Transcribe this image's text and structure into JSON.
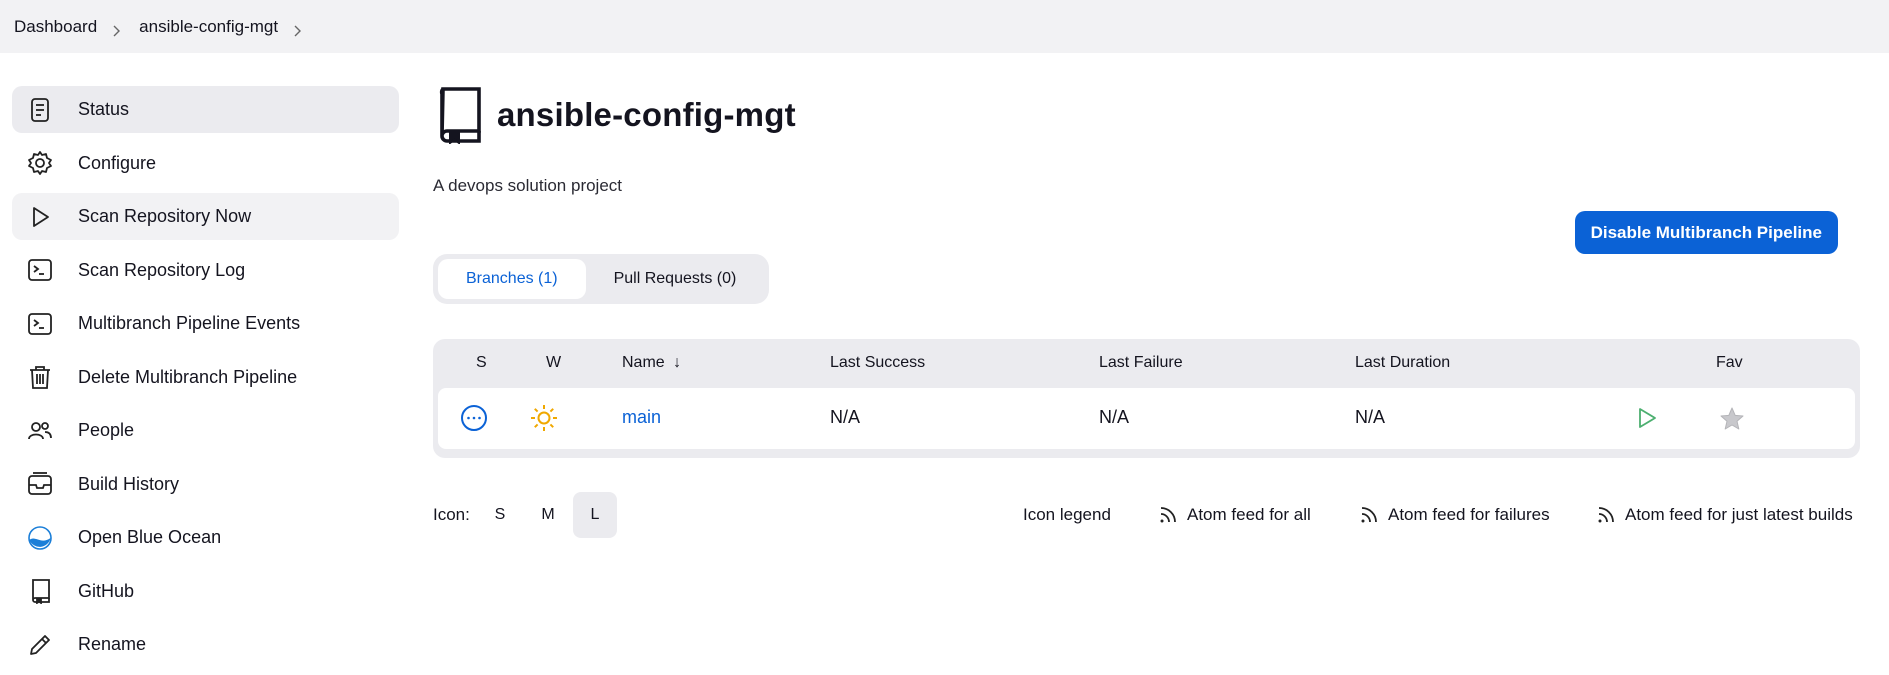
{
  "breadcrumb": [
    "Dashboard",
    "ansible-config-mgt"
  ],
  "sidebar": {
    "items": [
      {
        "label": "Status",
        "icon": "document-icon"
      },
      {
        "label": "Configure",
        "icon": "gear-icon"
      },
      {
        "label": "Scan Repository Now",
        "icon": "play-icon"
      },
      {
        "label": "Scan Repository Log",
        "icon": "terminal-icon"
      },
      {
        "label": "Multibranch Pipeline Events",
        "icon": "terminal-icon"
      },
      {
        "label": "Delete Multibranch Pipeline",
        "icon": "trash-icon"
      },
      {
        "label": "People",
        "icon": "people-icon"
      },
      {
        "label": "Build History",
        "icon": "inbox-icon"
      },
      {
        "label": "Open Blue Ocean",
        "icon": "blue-ocean-icon"
      },
      {
        "label": "GitHub",
        "icon": "repo-icon"
      },
      {
        "label": "Rename",
        "icon": "pencil-icon"
      }
    ]
  },
  "main": {
    "title": "ansible-config-mgt",
    "description": "A devops solution project",
    "disable_button": "Disable Multibranch Pipeline",
    "tabs": [
      {
        "label": "Branches (1)",
        "active": true
      },
      {
        "label": "Pull Requests (0)",
        "active": false
      }
    ]
  },
  "table": {
    "headers": {
      "s": "S",
      "w": "W",
      "name": "Name",
      "sort": "↓",
      "last_success": "Last Success",
      "last_failure": "Last Failure",
      "last_duration": "Last Duration",
      "fav": "Fav"
    },
    "rows": [
      {
        "status": "not-built",
        "weather": "sunny",
        "name": "main",
        "last_success": "N/A",
        "last_failure": "N/A",
        "last_duration": "N/A"
      }
    ]
  },
  "footer": {
    "icon_label": "Icon:",
    "sizes": [
      "S",
      "M",
      "L"
    ],
    "active_size": "L",
    "legend": "Icon legend",
    "feeds": [
      "Atom feed for all",
      "Atom feed for failures",
      "Atom feed for just latest builds"
    ]
  },
  "colors": {
    "accent": "#0b62d6",
    "weather": "#f0a800",
    "build_green": "#4caf70"
  }
}
